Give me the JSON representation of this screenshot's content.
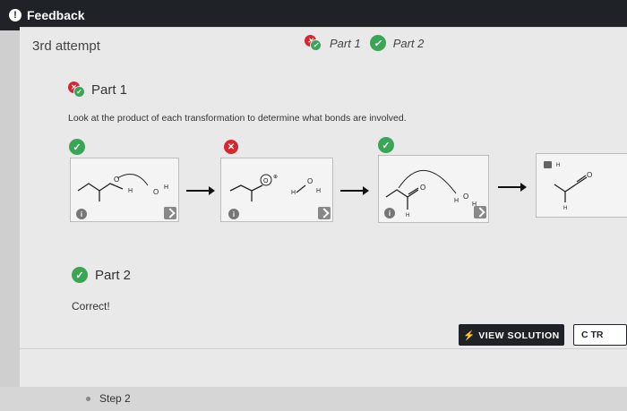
{
  "header": {
    "title": "Feedback",
    "icon": "alert-icon"
  },
  "attempt": {
    "label": "3rd attempt"
  },
  "parts_nav": [
    {
      "label": "Part 1",
      "status": "partially-correct"
    },
    {
      "label": "Part 2",
      "status": "correct"
    }
  ],
  "part1": {
    "title": "Part 1",
    "instruction": "Look at the product of each transformation to determine what bonds are involved."
  },
  "mechanism": {
    "steps": [
      {
        "status": "correct"
      },
      {
        "status": "incorrect"
      },
      {
        "status": "correct"
      },
      {
        "status": "locked"
      }
    ]
  },
  "part2": {
    "title": "Part 2",
    "feedback": "Correct!"
  },
  "actions": {
    "view_solution": "⚡ VIEW SOLUTION",
    "try_again": "C TR"
  },
  "footer": {
    "step": "Step 2"
  },
  "colors": {
    "correct": "#3aa655",
    "incorrect": "#d7262e",
    "dark": "#1f2327"
  }
}
